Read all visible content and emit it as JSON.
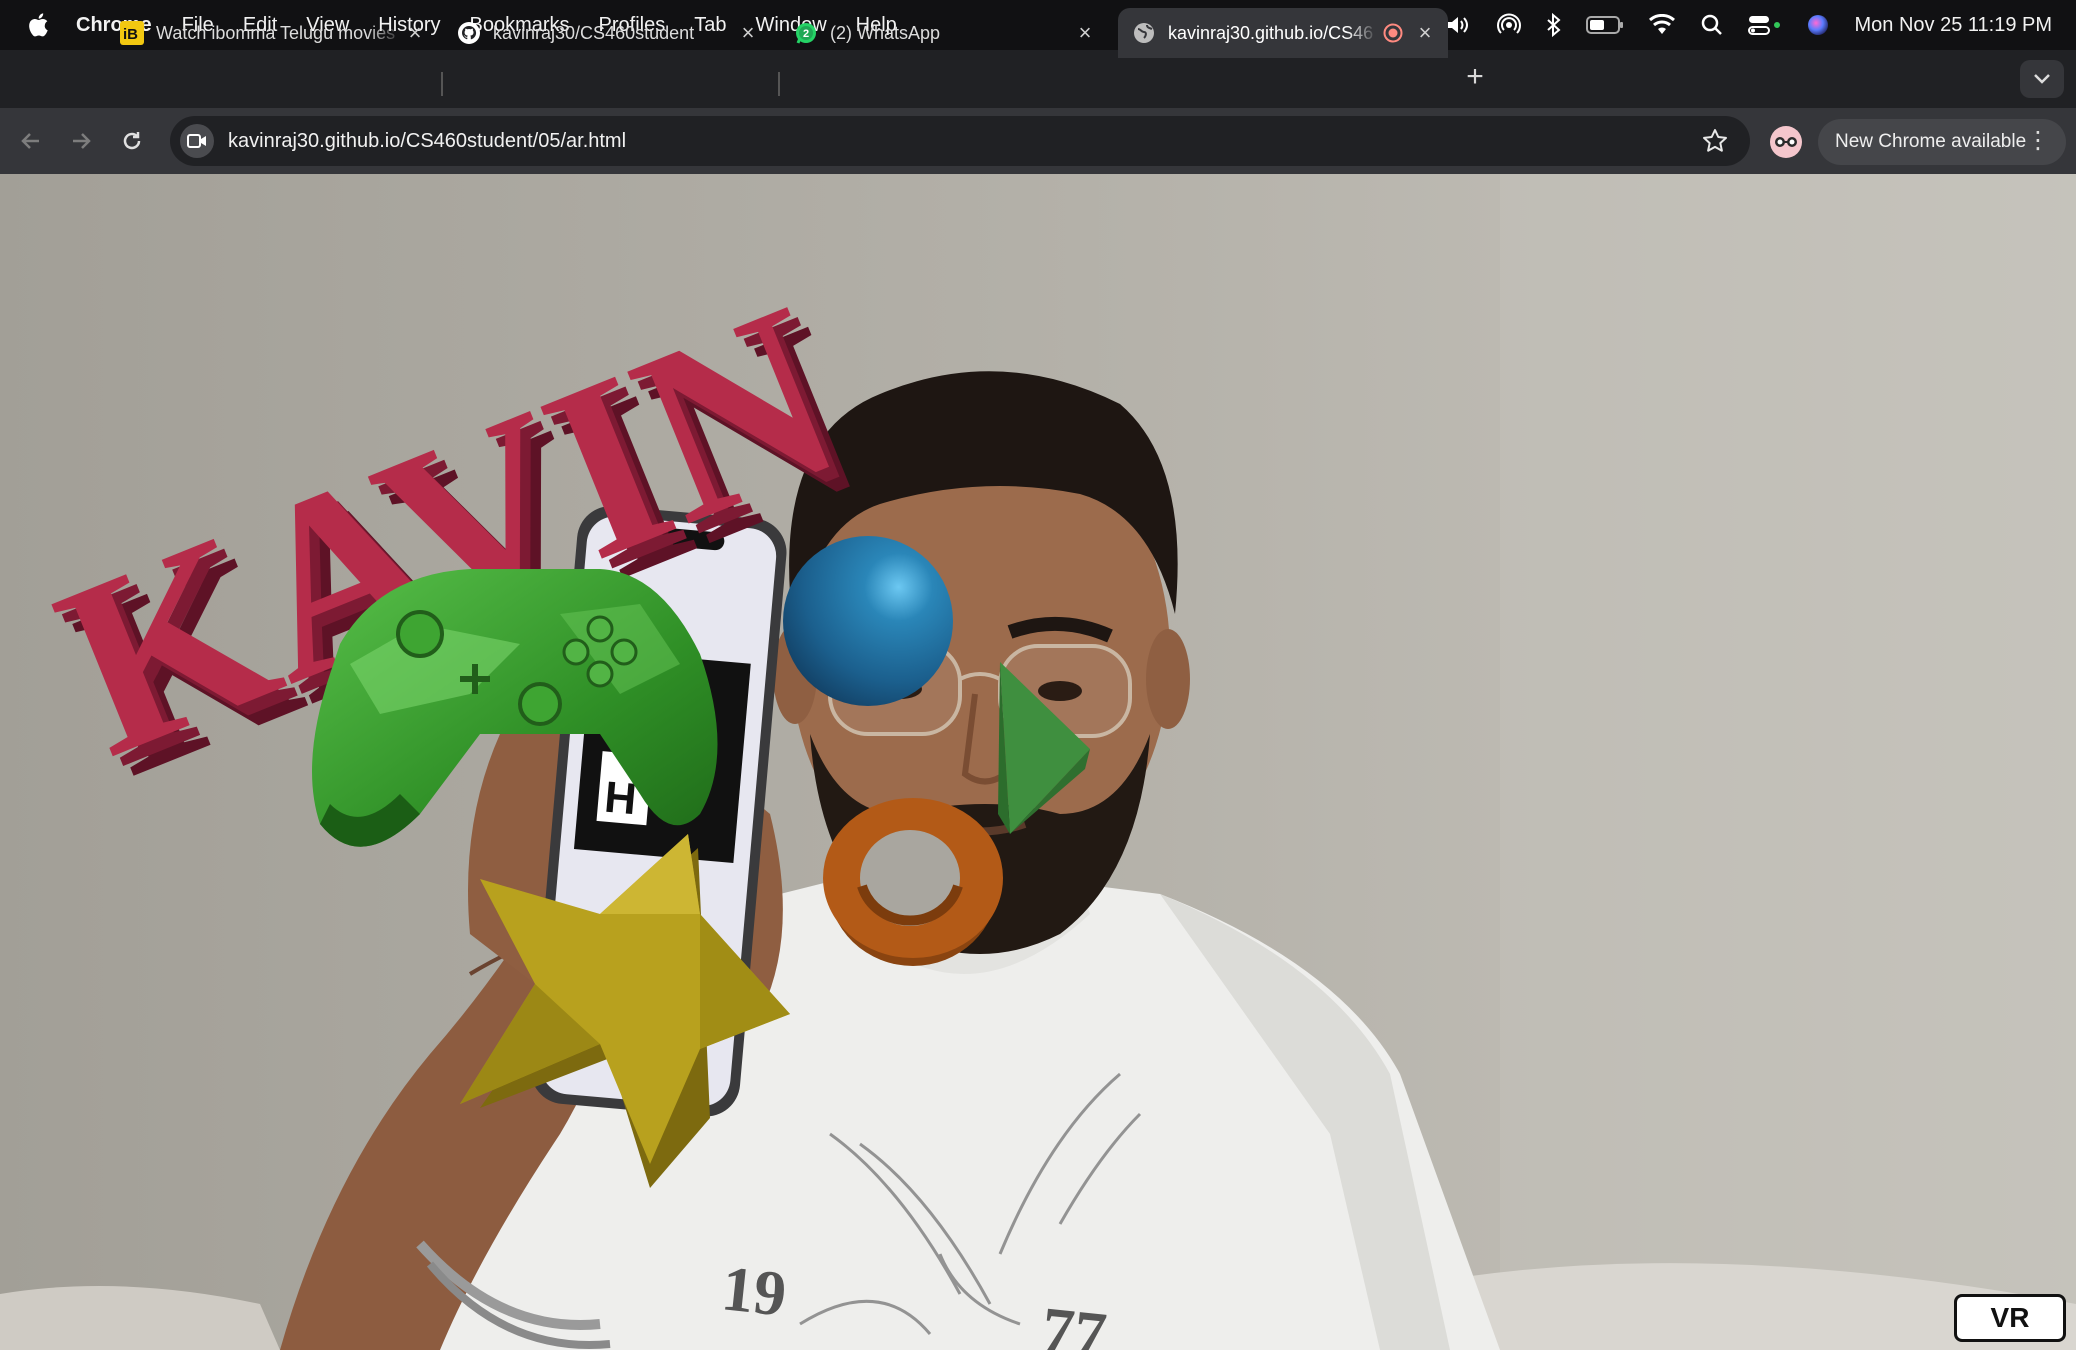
{
  "menubar": {
    "app_name": "Chrome",
    "items": [
      "File",
      "Edit",
      "View",
      "History",
      "Bookmarks",
      "Profiles",
      "Tab",
      "Window",
      "Help"
    ],
    "clock": "Mon Nov 25  11:19 PM",
    "status_icons": [
      "facetime-icon",
      "layers-icon",
      "emoji-icon",
      "play-icon",
      "volume-icon",
      "airdrop-icon",
      "bluetooth-icon",
      "battery-icon",
      "wifi-icon",
      "spotlight-icon",
      "control-center-icon",
      "siri-icon"
    ],
    "facetime_color": "#33c759"
  },
  "tabs": [
    {
      "title": "Watch ibomma Telugu movies",
      "favicon": "ibomma-icon",
      "active": false
    },
    {
      "title": "kavinraj30/CS460student",
      "favicon": "github-icon",
      "active": false
    },
    {
      "title": "(2) WhatsApp",
      "favicon": "whatsapp-icon",
      "badge": "2",
      "active": false
    },
    {
      "title": "kavinraj30.github.io/CS46",
      "favicon": "globe-icon",
      "active": true,
      "recording": true
    }
  ],
  "toolbar": {
    "url": "kavinraj30.github.io/CS460student/05/ar.html",
    "update_label": "New Chrome available"
  },
  "scene": {
    "ar_text": "KAVIN",
    "shirt_text_left": "19",
    "shirt_text_right": "77",
    "objects": [
      "kavin-3d-text",
      "green-controller-model",
      "blue-sphere",
      "green-cone",
      "orange-torus",
      "yellow-star"
    ],
    "colors": {
      "text": "#b52c4a",
      "controller": "#3c9a2e",
      "sphere": "#1e6a9a",
      "cone": "#3f8f3f",
      "torus": "#b35a17",
      "star": "#b8a11e"
    }
  },
  "vr_button": {
    "label": "VR"
  }
}
